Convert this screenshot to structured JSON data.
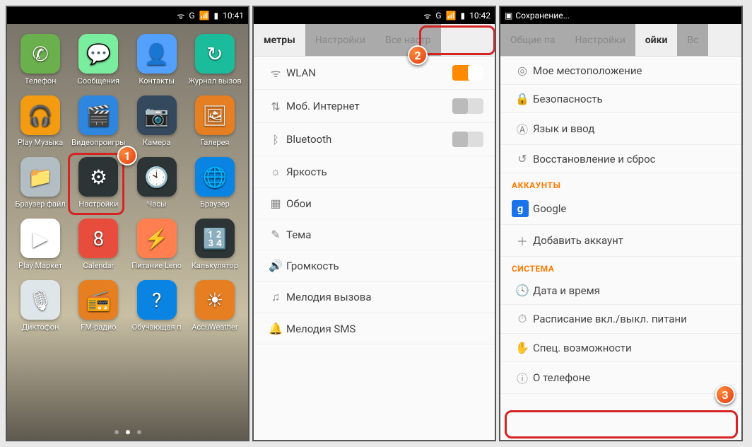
{
  "status": {
    "time1": "10:41",
    "time2": "10:42",
    "signal_text": "G",
    "saving_text": "Сохранение..."
  },
  "badges": {
    "b1": "1",
    "b2": "2",
    "b3": "3"
  },
  "home": {
    "apps": [
      {
        "name": "phone",
        "label": "Телефон",
        "bg": "#6ab04c",
        "glyph": "✆"
      },
      {
        "name": "messages",
        "label": "Сообщения",
        "bg": "#7bed9f",
        "glyph": "💬"
      },
      {
        "name": "contacts",
        "label": "Контакты",
        "bg": "#54a0ff",
        "glyph": "👤"
      },
      {
        "name": "call-log",
        "label": "Журнал вызов",
        "bg": "#1abc9c",
        "glyph": "↻"
      },
      {
        "name": "play-music",
        "label": "Play Музыка",
        "bg": "#f39c12",
        "glyph": "🎧"
      },
      {
        "name": "video",
        "label": "Видеопроигры",
        "bg": "#2e86de",
        "glyph": "🎬"
      },
      {
        "name": "camera",
        "label": "Камера",
        "bg": "#34495e",
        "glyph": "📷"
      },
      {
        "name": "gallery",
        "label": "Галерея",
        "bg": "#e67e22",
        "glyph": "🖼"
      },
      {
        "name": "file-browser",
        "label": "Браузер файл",
        "bg": "#b2bec3",
        "glyph": "📁"
      },
      {
        "name": "settings",
        "label": "Настройки",
        "bg": "#2d3436",
        "glyph": "⚙"
      },
      {
        "name": "clock",
        "label": "Часы",
        "bg": "#2d3436",
        "glyph": "🕙"
      },
      {
        "name": "browser",
        "label": "Браузер",
        "bg": "#0984e3",
        "glyph": "🌐"
      },
      {
        "name": "play-store",
        "label": "Play Маркет",
        "bg": "#ffffff",
        "glyph": "▶"
      },
      {
        "name": "calendar",
        "label": "Calendar",
        "bg": "#e74c3c",
        "glyph": "8"
      },
      {
        "name": "lenovo-power",
        "label": "Питание Leno",
        "bg": "#ff7f50",
        "glyph": "⚡"
      },
      {
        "name": "calculator",
        "label": "Калькулятор",
        "bg": "#2d3436",
        "glyph": "🔢"
      },
      {
        "name": "recorder",
        "label": "Диктофон",
        "bg": "#dfe6e9",
        "glyph": "🎙"
      },
      {
        "name": "fm-radio",
        "label": "FM-радио",
        "bg": "#e67e22",
        "glyph": "📻"
      },
      {
        "name": "tutorial",
        "label": "Обучающая п",
        "bg": "#0984e3",
        "glyph": "?"
      },
      {
        "name": "accuweather",
        "label": "AccuWeather",
        "bg": "#e67e22",
        "glyph": "☀"
      }
    ]
  },
  "screen2": {
    "tabs": [
      {
        "label": "метры",
        "active": true
      },
      {
        "label": "Настройки",
        "active": false
      },
      {
        "label": "Все настр",
        "active": false
      }
    ],
    "rows": [
      {
        "icon": "wifi",
        "glyph": "ᯤ",
        "label": "WLAN",
        "toggle": "on"
      },
      {
        "icon": "mobile-data",
        "glyph": "⇅",
        "label": "Моб. Интернет",
        "toggle": "off"
      },
      {
        "icon": "bluetooth",
        "glyph": "ᛒ",
        "label": "Bluetooth",
        "toggle": "off"
      },
      {
        "icon": "brightness",
        "glyph": "☼",
        "label": "Яркость"
      },
      {
        "icon": "wallpaper",
        "glyph": "▦",
        "label": "Обои"
      },
      {
        "icon": "theme",
        "glyph": "✎",
        "label": "Тема"
      },
      {
        "icon": "volume",
        "glyph": "🔊",
        "label": "Громкость"
      },
      {
        "icon": "ringtone",
        "glyph": "♫",
        "label": "Мелодия вызова"
      },
      {
        "icon": "sms-tone",
        "glyph": "🔔",
        "label": "Мелодия SMS"
      }
    ]
  },
  "screen3": {
    "tabs": [
      {
        "label": "Общие па",
        "active": false
      },
      {
        "label": "Настройки",
        "active": false
      },
      {
        "label": "ойки",
        "active": true
      },
      {
        "label": "Вс",
        "active": false
      }
    ],
    "top_rows": [
      {
        "icon": "location",
        "glyph": "◎",
        "label": "Мое местоположение"
      },
      {
        "icon": "security",
        "glyph": "🔒",
        "label": "Безопасность"
      },
      {
        "icon": "language",
        "glyph": "Ⓐ",
        "label": "Язык и ввод"
      },
      {
        "icon": "reset",
        "glyph": "↺",
        "label": "Восстановление и сброс"
      }
    ],
    "section_accounts": "АККАУНТЫ",
    "accounts": [
      {
        "icon": "google",
        "label": "Google",
        "google": true
      },
      {
        "icon": "add-account",
        "glyph": "＋",
        "label": "Добавить аккаунт"
      }
    ],
    "section_system": "СИСТЕМА",
    "system_rows": [
      {
        "icon": "date-time",
        "glyph": "🕓",
        "label": "Дата и время"
      },
      {
        "icon": "schedule-power",
        "glyph": "⏱",
        "label": "Расписание вкл./выкл. питани"
      },
      {
        "icon": "accessibility",
        "glyph": "✋",
        "label": "Спец. возможности"
      },
      {
        "icon": "about-phone",
        "glyph": "ⓘ",
        "label": "О телефоне"
      }
    ]
  }
}
